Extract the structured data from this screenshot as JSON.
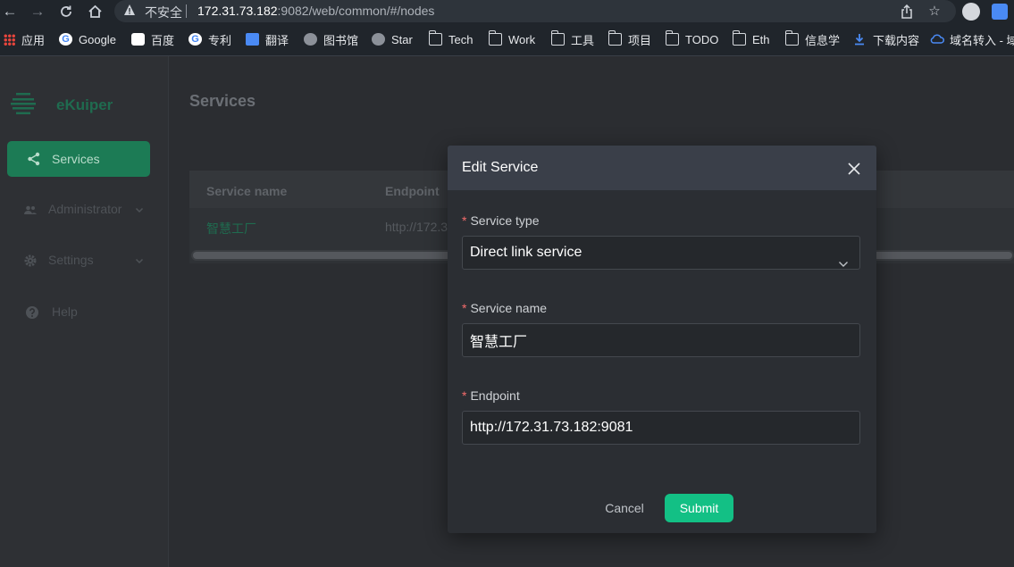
{
  "browser": {
    "insecure_label": "不安全",
    "url_host": "172.31.73.182",
    "url_rest": ":9082/web/common/#/nodes",
    "bookmarks": [
      {
        "label": "应用",
        "icon": "apps-grid-icon"
      },
      {
        "label": "Google",
        "icon": "google-icon"
      },
      {
        "label": "百度",
        "icon": "baidu-icon"
      },
      {
        "label": "专利",
        "icon": "google-icon"
      },
      {
        "label": "翻译",
        "icon": "translate-icon"
      },
      {
        "label": "图书馆",
        "icon": "globe-icon"
      },
      {
        "label": "Star",
        "icon": "globe-icon"
      },
      {
        "label": "Tech",
        "icon": "folder-icon"
      },
      {
        "label": "Work",
        "icon": "folder-icon"
      },
      {
        "label": "工具",
        "icon": "folder-icon"
      },
      {
        "label": "项目",
        "icon": "folder-icon"
      },
      {
        "label": "TODO",
        "icon": "folder-icon"
      },
      {
        "label": "Eth",
        "icon": "folder-icon"
      },
      {
        "label": "信息学",
        "icon": "folder-icon"
      },
      {
        "label": "下载内容",
        "icon": "download-icon"
      },
      {
        "label": "域名转入 - 域",
        "icon": "cloud-icon"
      }
    ]
  },
  "sidebar": {
    "logo": "eKuiper",
    "active": "Services",
    "items": [
      {
        "label": "Administrator"
      },
      {
        "label": "Settings"
      },
      {
        "label": "Help"
      }
    ]
  },
  "main": {
    "title": "Services",
    "table": {
      "headers": [
        "Service name",
        "Endpoint"
      ],
      "rows": [
        {
          "name": "智慧工厂",
          "endpoint": "http://172.3"
        }
      ]
    }
  },
  "dialog": {
    "title": "Edit Service",
    "required_mark": "*",
    "service_type_label": "Service type",
    "service_type_value": "Direct link service",
    "service_name_label": "Service name",
    "service_name_value": "智慧工厂",
    "endpoint_label": "Endpoint",
    "endpoint_value": "http://172.31.73.182:9081",
    "cancel_label": "Cancel",
    "submit_label": "Submit"
  },
  "colors": {
    "accent": "#13c085",
    "sidebar_active": "#1c7b55",
    "required": "#f56c6c"
  }
}
